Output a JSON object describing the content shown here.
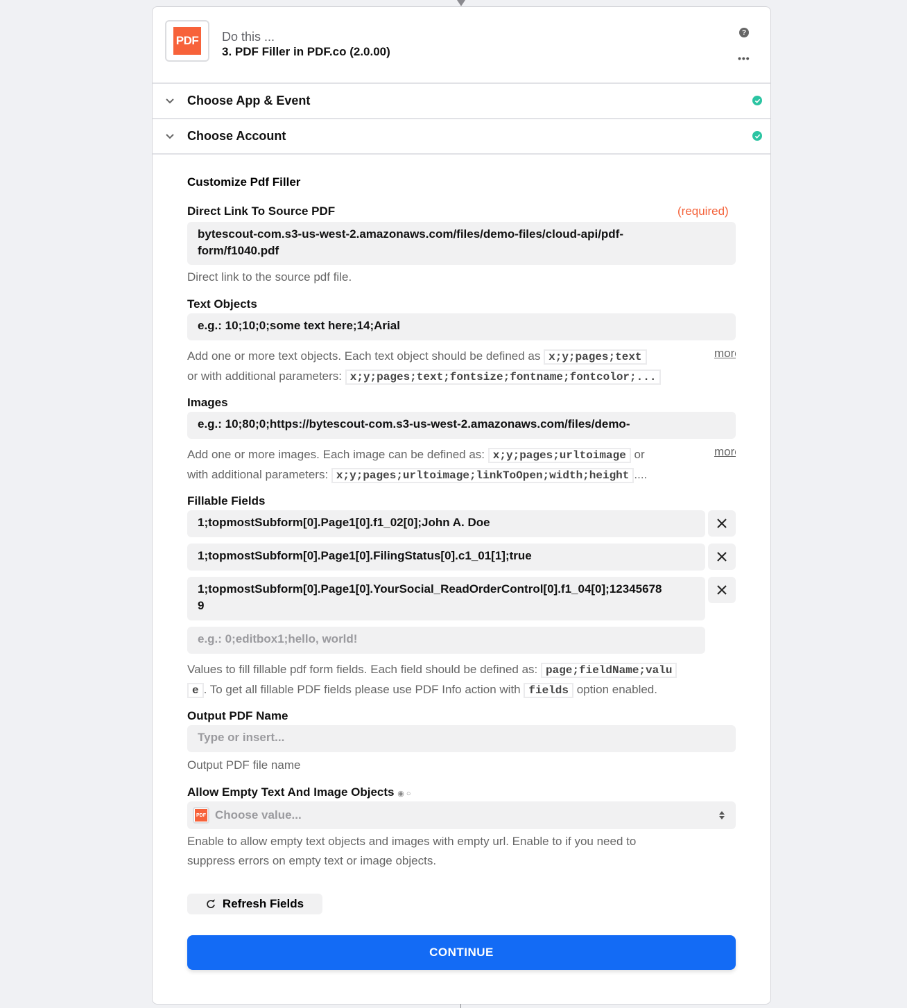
{
  "header": {
    "app_logo_text": "PDF",
    "subtitle": "Do this ...",
    "title": "3. PDF Filler in PDF.co (2.0.00)",
    "help_icon": "?",
    "more_icon": "..."
  },
  "sections": [
    {
      "label": "Choose App & Event",
      "status": "complete"
    },
    {
      "label": "Choose Account",
      "status": "complete"
    }
  ],
  "form": {
    "title": "Customize Pdf Filler",
    "direct_link": {
      "label": "Direct Link To Source PDF",
      "required_label": "(required)",
      "value_line1": "bytescout-com.s3-us-west-2.amazonaws.com/files/demo-files/cloud-api/pdf-",
      "value_line2": "form/f1040.pdf",
      "help": "Direct link to the source pdf file."
    },
    "text_objects": {
      "label": "Text Objects",
      "placeholder": "e.g.: 10;10;0;some text here;14;Arial",
      "help_part1": "Add one or more text objects. Each text object should be defined as",
      "help_code1": "x;y;pages;text",
      "help_part2": "or with additional parameters:",
      "help_code2": "x;y;pages;text;fontsize;fontname;fontcolor;...",
      "more_label": "more"
    },
    "images": {
      "label": "Images",
      "placeholder": "e.g.: 10;80;0;https://bytescout-com.s3-us-west-2.amazonaws.com/files/demo-",
      "help_part1": "Add one or more images. Each image can be defined as:",
      "help_code1": "x;y;pages;urltoimage",
      "help_part2": "or",
      "help_part3": "with additional parameters:",
      "help_code2": "x;y;pages;urltoimage;linkToOpen;width;height",
      "help_part4": "....",
      "more_label": "more"
    },
    "fillable_fields": {
      "label": "Fillable Fields",
      "items": [
        {
          "value": "1;topmostSubform[0].Page1[0].f1_02[0];John A. Doe"
        },
        {
          "value": "1;topmostSubform[0].Page1[0].FilingStatus[0].c1_01[1];true"
        },
        {
          "value_line1": "1;topmostSubform[0].Page1[0].YourSocial_ReadOrderControl[0].f1_04[0];12345678",
          "value_line2": "9"
        }
      ],
      "placeholder": "e.g.: 0;editbox1;hello, world!",
      "help_part1": "Values to fill fillable pdf form fields. Each field should be defined as:",
      "help_code1a": "page;fieldName;valu",
      "help_code1b": "e",
      "help_part2": ". To get all fillable PDF fields please use PDF Info action with",
      "help_code2": "fields",
      "help_part3": "option enabled."
    },
    "output_name": {
      "label": "Output PDF Name",
      "placeholder": "Type or insert...",
      "help": "Output PDF file name"
    },
    "allow_empty": {
      "label": "Allow Empty Text And Image Objects",
      "radio_icons": "◉ ○",
      "select_logo": "PDF",
      "placeholder": "Choose value...",
      "help_line1": "Enable to allow empty text objects and images with empty url. Enable to if you need to",
      "help_line2": "suppress errors on empty text or image objects."
    },
    "refresh_label": "Refresh Fields",
    "continue_label": "CONTINUE"
  },
  "colors": {
    "accent": "#136bf5",
    "brand": "#f7623a",
    "success": "#2bc4a2",
    "required": "#f4623a"
  }
}
